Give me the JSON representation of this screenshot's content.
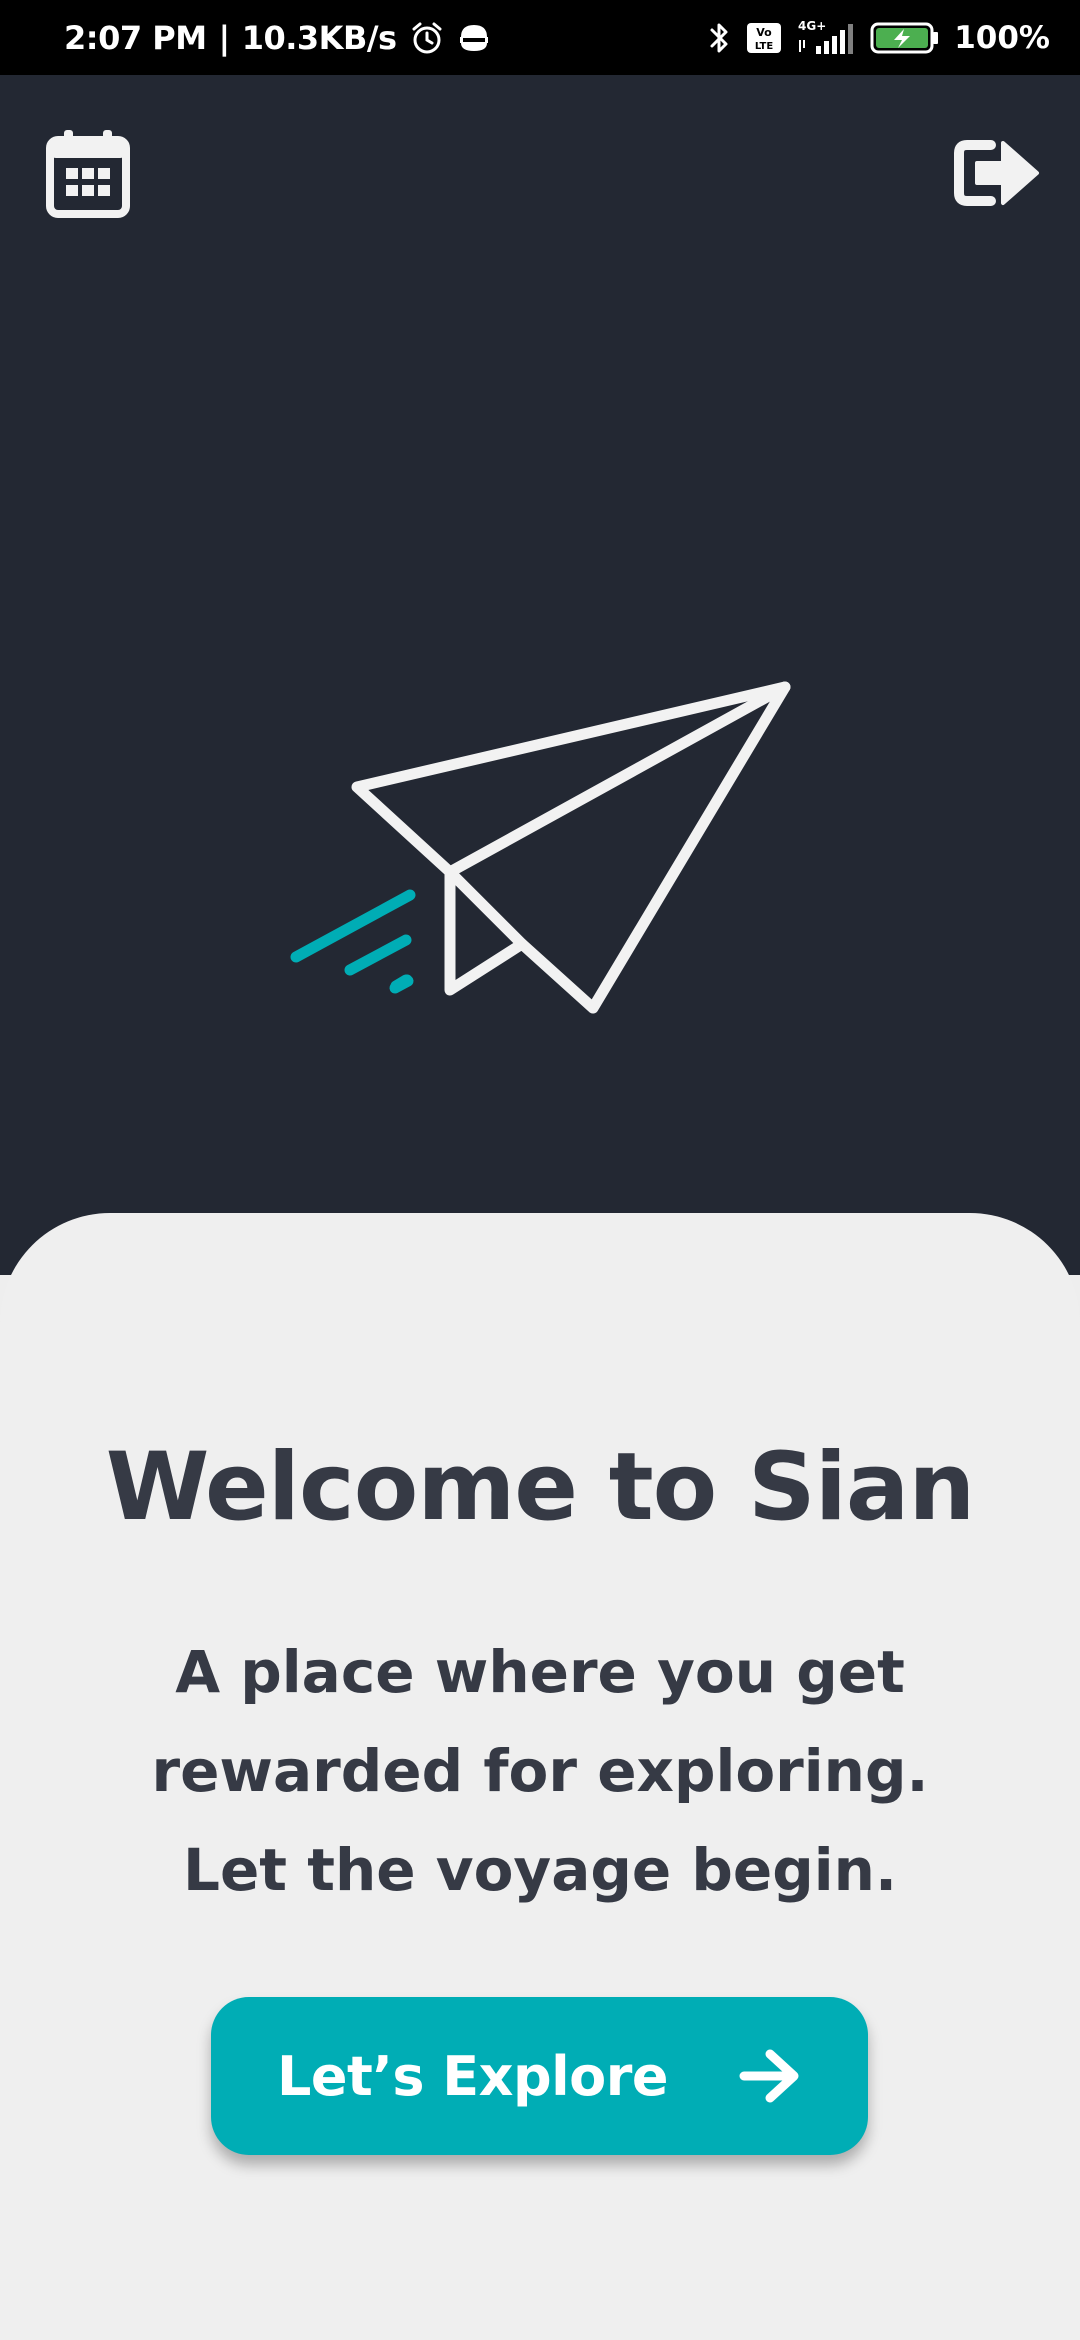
{
  "status_bar": {
    "time": "2:07 PM",
    "network_speed": "10.3KB/s",
    "battery_percent": "100%",
    "network_type": "4G+",
    "volte": "Vo LTE",
    "icons": [
      "alarm-icon",
      "burger-king-app-icon",
      "bluetooth-icon",
      "volte-icon",
      "signal-icon",
      "battery-charging-icon"
    ]
  },
  "header": {
    "left_icon": "calendar-icon",
    "right_icon": "logout-icon"
  },
  "hero": {
    "illustration": "paper-plane-icon",
    "accent_color": "#00adb5"
  },
  "welcome": {
    "title": "Welcome to Sian",
    "subtitle_lines": [
      "A place where you get",
      "rewarded for exploring.",
      "Let the voyage begin."
    ]
  },
  "cta": {
    "label": "Let’s Explore",
    "icon": "arrow-right-icon",
    "color": "#00adb5"
  },
  "colors": {
    "hero_background": "#232833",
    "card_background": "#efefef",
    "text": "#363a45"
  }
}
